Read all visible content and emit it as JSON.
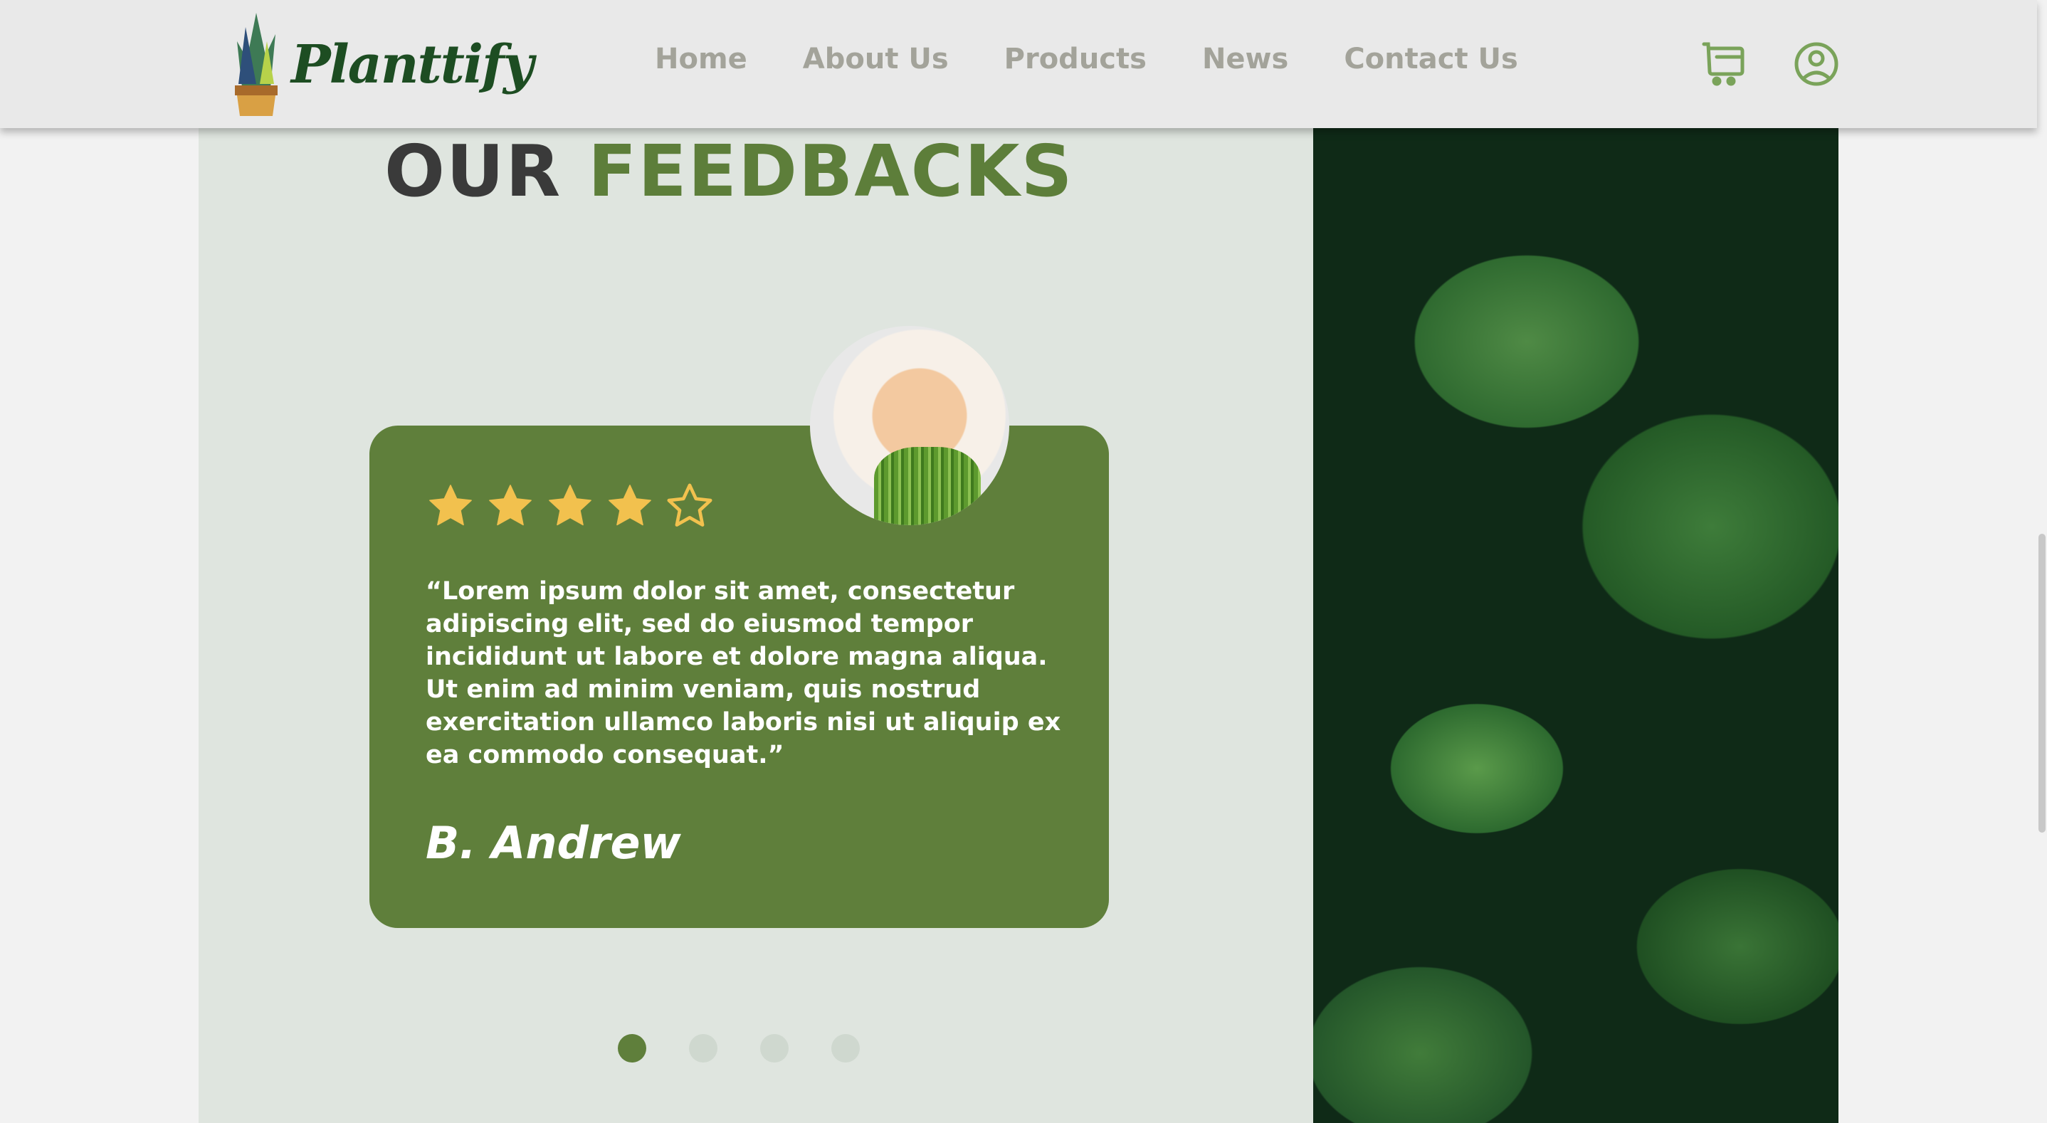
{
  "header": {
    "brand": "Planttify",
    "nav": [
      "Home",
      "About Us",
      "Products",
      "News",
      "Contact Us"
    ],
    "icons": [
      "cart-icon",
      "user-icon"
    ]
  },
  "section": {
    "title_part1": "OUR",
    "title_part2": "FEEDBACKS"
  },
  "testimonial": {
    "rating": 4,
    "max_rating": 5,
    "quote": "“Lorem ipsum dolor sit amet, consectetur adipiscing elit, sed do eiusmod tempor incididunt ut labore et dolore magna aliqua. Ut enim ad minim veniam, quis nostrud exercitation ullamco laboris nisi ut aliquip ex ea commodo consequat.”",
    "author": "B. Andrew"
  },
  "carousel": {
    "total": 4,
    "active": 1
  },
  "colors": {
    "accent": "#5f7f3b",
    "star": "#f2c14e",
    "nav": "#a3a39a"
  }
}
